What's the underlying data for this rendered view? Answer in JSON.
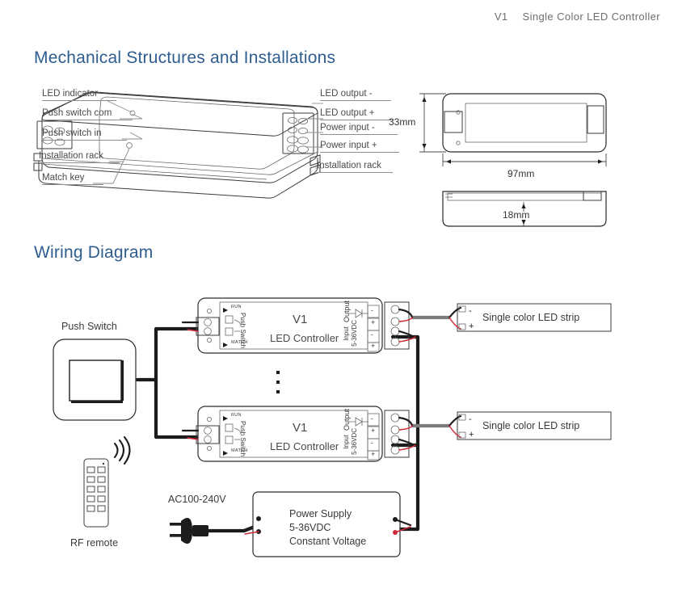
{
  "header": {
    "model": "V1",
    "title": "Single Color LED Controller"
  },
  "sections": {
    "mechanical": "Mechanical Structures and Installations",
    "wiring": "Wiring Diagram"
  },
  "mechanical": {
    "left_labels": [
      "LED indicator",
      "Push switch com",
      "Push switch in",
      "Installation rack",
      "Match key"
    ],
    "right_labels": [
      "LED output -",
      "LED output +",
      "Power input -",
      "Power input +",
      "Installation rack"
    ],
    "dimensions": {
      "height": "33mm",
      "length": "97mm",
      "depth": "18mm"
    }
  },
  "wiring": {
    "push_switch_label": "Push Switch",
    "rf_remote_label": "RF remote",
    "ac_input_label": "AC100-240V",
    "power_supply": {
      "line1": "Power Supply",
      "line2": "5-36VDC",
      "line3": "Constant Voltage"
    },
    "controllers": [
      {
        "model": "V1",
        "subtitle": "LED Controller",
        "run_label": "RUN",
        "match_label": "MATCH",
        "push_switch_label": "Push Switch",
        "output_label": "Output",
        "input_label": "Input",
        "input_voltage": "5-36VDC",
        "terminal_minus": "-",
        "terminal_plus": "+"
      },
      {
        "model": "V1",
        "subtitle": "LED Controller",
        "run_label": "RUN",
        "match_label": "MATCH",
        "push_switch_label": "Push Switch",
        "output_label": "Output",
        "input_label": "Input",
        "input_voltage": "5-36VDC",
        "terminal_minus": "-",
        "terminal_plus": "+"
      }
    ],
    "led_strips": [
      {
        "label": "Single color LED strip",
        "minus": "-",
        "plus": "+"
      },
      {
        "label": "Single color LED strip",
        "minus": "-",
        "plus": "+"
      }
    ],
    "repeat_indicator": "vertical-ellipsis"
  },
  "colors": {
    "heading": "#2e5d8e",
    "header_text": "#6e6e6e",
    "wire_positive": "#cf2b3a",
    "wire_negative": "#1c1c1c",
    "wire_bundle": "#7d7d7d"
  }
}
